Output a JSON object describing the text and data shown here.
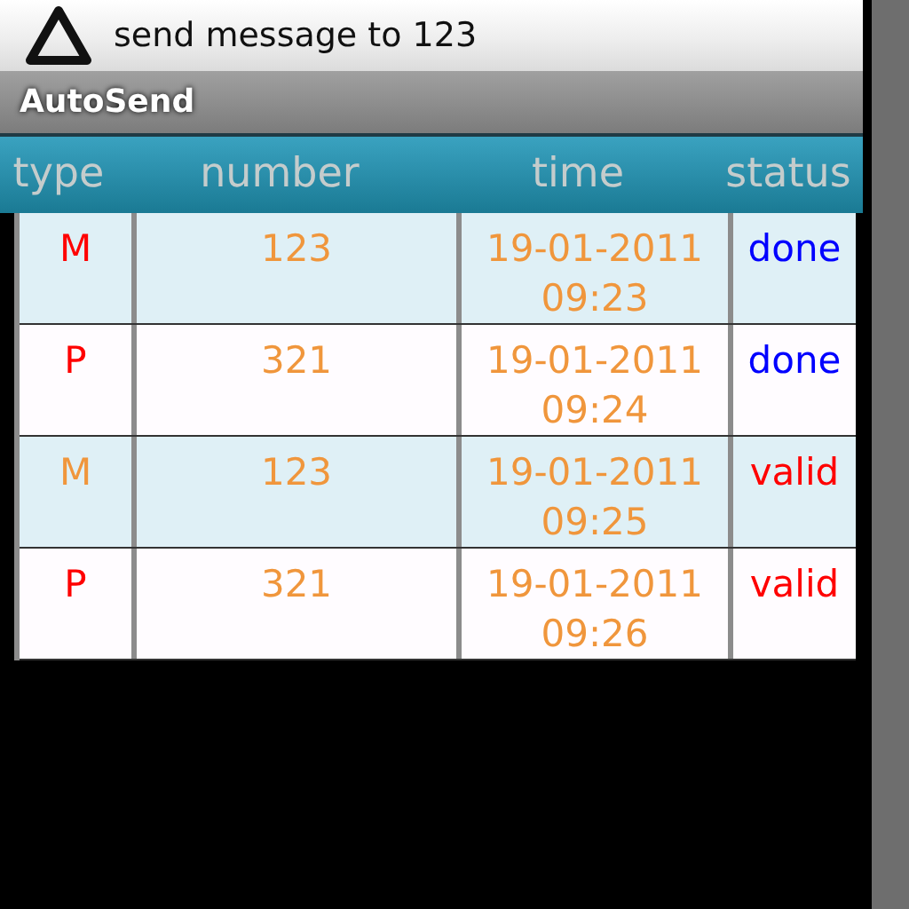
{
  "notification": {
    "text": "send message to 123"
  },
  "app_title": "AutoSend",
  "table": {
    "columns": [
      "type",
      "number",
      "time",
      "status"
    ],
    "rows": [
      [
        {
          "text": "M",
          "color": "#ff0000"
        },
        {
          "text": "123",
          "color": "#f0963c"
        },
        {
          "text": "19-01-2011 09:23",
          "color": "#f0963c"
        },
        {
          "text": "done",
          "color": "#0000ff"
        }
      ],
      [
        {
          "text": "P",
          "color": "#ff0000"
        },
        {
          "text": "321",
          "color": "#f0963c"
        },
        {
          "text": "19-01-2011 09:24",
          "color": "#f0963c"
        },
        {
          "text": "done",
          "color": "#0000ff"
        }
      ],
      [
        {
          "text": "M",
          "color": "#f0963c"
        },
        {
          "text": "123",
          "color": "#f0963c"
        },
        {
          "text": "19-01-2011 09:25",
          "color": "#f0963c"
        },
        {
          "text": "valid",
          "color": "#ff0000"
        }
      ],
      [
        {
          "text": "P",
          "color": "#ff0000"
        },
        {
          "text": "321",
          "color": "#f0963c"
        },
        {
          "text": "19-01-2011 09:26",
          "color": "#f0963c"
        },
        {
          "text": "valid",
          "color": "#ff0000"
        }
      ]
    ]
  }
}
